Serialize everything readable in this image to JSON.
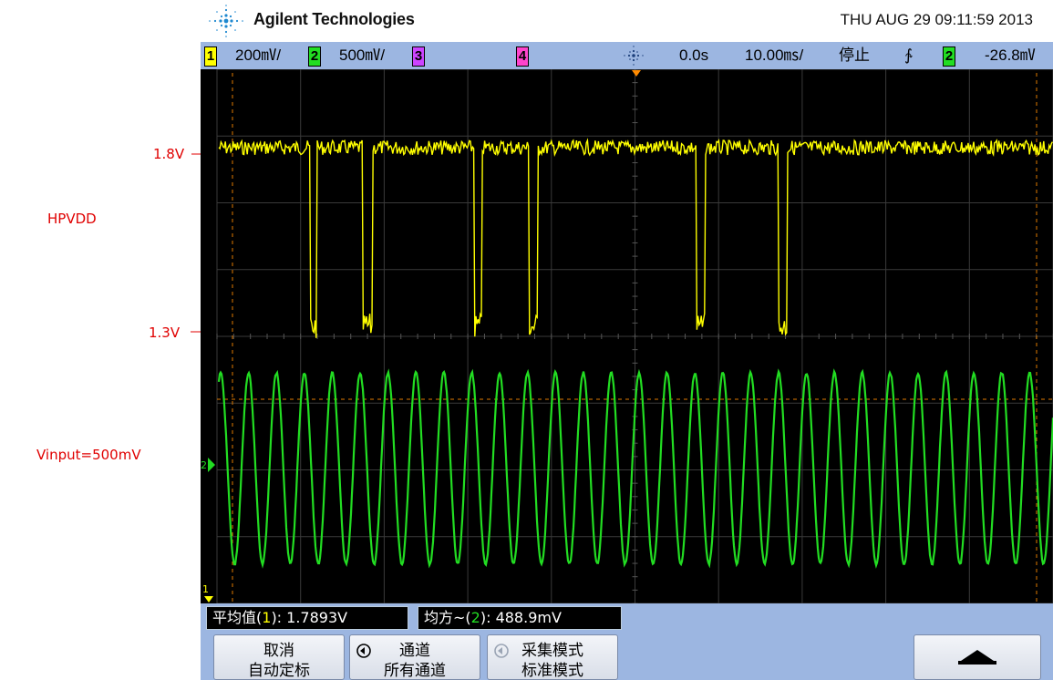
{
  "annotations": {
    "v18": "1.8V",
    "hpvdd": "HPVDD",
    "v13": "1.3V",
    "vinput": "Vinput=500mV"
  },
  "header": {
    "brand": "Agilent Technologies",
    "datetime": "THU AUG 29 09:11:59 2013"
  },
  "status": {
    "ch1_num": "1",
    "ch1_scale": "200㎷/",
    "ch2_num": "2",
    "ch2_scale": "500㎷/",
    "ch3_num": "3",
    "ch4_num": "4",
    "time_delay": "0.0s",
    "time_scale": "10.00㎳/",
    "run_state": "停止",
    "trigger_slope": "∱",
    "trig_ch_num": "2",
    "trig_level": "-26.8㎷"
  },
  "screen_markers": {
    "ch2_marker": "2",
    "ch1_marker": "1"
  },
  "measurements": {
    "m1_label": "平均值(",
    "m1_ch": "1",
    "m1_value": "): 1.7893V",
    "m2_label": "均方~(",
    "m2_ch": "2",
    "m2_value": "): 488.9mV"
  },
  "softkeys": {
    "k1_line1": "取消",
    "k1_line2": "自动定标",
    "k2_line1": "通道",
    "k2_line2": "所有通道",
    "k3_line1": "采集模式",
    "k3_line2": "标准模式",
    "k4_icon": "up-arrow-icon"
  },
  "colors": {
    "ch1": "#ffff00",
    "ch2": "#22dd22",
    "ch3": "#cc44ff",
    "ch4": "#ff44cc",
    "statusbar": "#9cb6e1",
    "annotation": "#e00000"
  }
}
